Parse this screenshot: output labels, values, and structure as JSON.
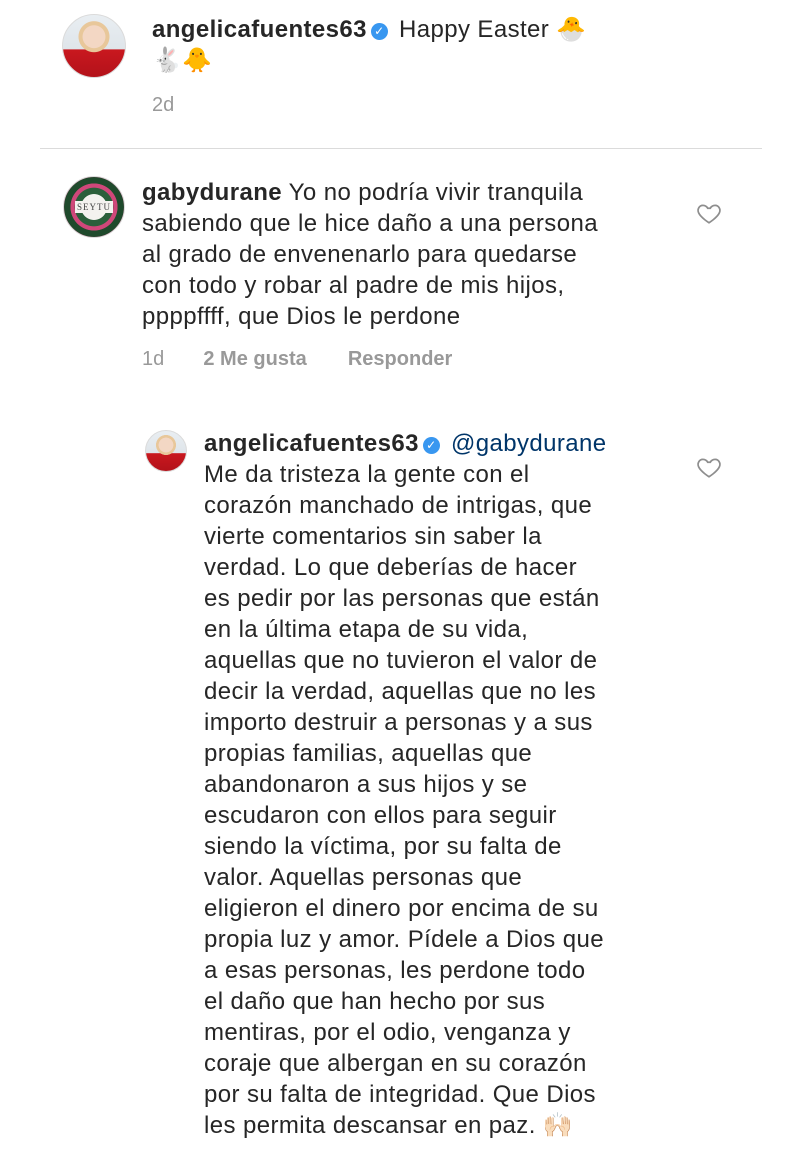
{
  "caption": {
    "username": "angelicafuentes63",
    "text": "Happy Easter",
    "emoji_after_text": "🐣",
    "emoji_line2": "🐇🐥",
    "time": "2d"
  },
  "comment": {
    "username": "gabydurane",
    "avatar_text": "SEYTU",
    "lines": [
      "Yo no podría vivir tranquila",
      "sabiendo que le hice daño a una persona",
      "al grado de envenenarlo para quedarse",
      "con todo y robar al padre de mis hijos,",
      "ppppffff, que Dios le perdone"
    ],
    "time": "1d",
    "likes": "2 Me gusta",
    "reply_label": "Responder"
  },
  "reply": {
    "username": "angelicafuentes63",
    "mention": "@gabydurane",
    "lines": [
      "Me da tristeza la gente con el",
      "corazón manchado de intrigas, que",
      "vierte comentarios sin saber la",
      "verdad. Lo que deberías de hacer",
      "es pedir por las personas que están",
      "en la última etapa de su vida,",
      "aquellas que no tuvieron el valor de",
      "decir la verdad, aquellas que no les",
      "importo destruir a personas y a sus",
      "propias familias, aquellas que",
      "abandonaron a sus hijos y se",
      "escudaron con ellos para seguir",
      "siendo la víctima, por su falta de",
      "valor.  Aquellas personas que",
      "eligieron el dinero por encima de su",
      "propia luz y amor. Pídele a Dios que",
      "a esas personas, les perdone todo",
      "el daño que han hecho por sus",
      "mentiras, por el odio, venganza y",
      "coraje que albergan en su corazón",
      "por su falta de integridad. Que Dios",
      "les permita descansar en paz. 🙌🏻"
    ]
  },
  "icons": {
    "verified": "verified-badge-icon",
    "like": "heart-icon"
  },
  "colors": {
    "text": "#262626",
    "meta": "#999999",
    "verified": "#3897f0",
    "mention": "#003569"
  }
}
